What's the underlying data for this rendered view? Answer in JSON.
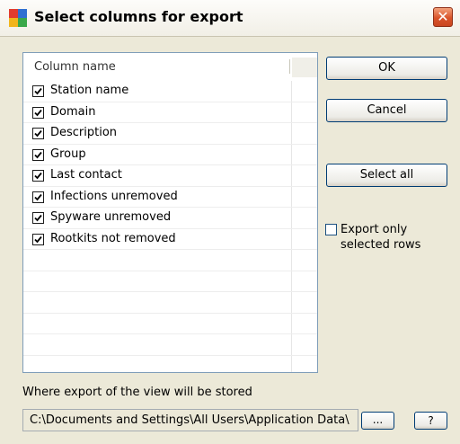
{
  "window": {
    "title": "Select columns for export",
    "close_glyph": "✕"
  },
  "list": {
    "header": "Column name",
    "items": [
      {
        "label": "Station name",
        "checked": true
      },
      {
        "label": "Domain",
        "checked": true
      },
      {
        "label": "Description",
        "checked": true
      },
      {
        "label": "Group",
        "checked": true
      },
      {
        "label": "Last contact",
        "checked": true
      },
      {
        "label": "Infections unremoved",
        "checked": true
      },
      {
        "label": "Spyware unremoved",
        "checked": true
      },
      {
        "label": "Rootkits not removed",
        "checked": true
      }
    ]
  },
  "buttons": {
    "ok": "OK",
    "cancel": "Cancel",
    "select_all": "Select all",
    "browse": "...",
    "help": "?"
  },
  "export_option": {
    "label": "Export only selected rows",
    "checked": false
  },
  "storage": {
    "label": "Where export of the view will be stored",
    "path": "C:\\Documents and Settings\\All Users\\Application Data\\"
  },
  "colors": {
    "dialog_bg": "#ece9d8",
    "close_button": "#d9542b",
    "button_border": "#003c74",
    "list_border": "#7f9db9"
  },
  "icons": {
    "app": "avg-app-icon",
    "close": "close-icon",
    "checkbox": "checkmark-icon"
  }
}
